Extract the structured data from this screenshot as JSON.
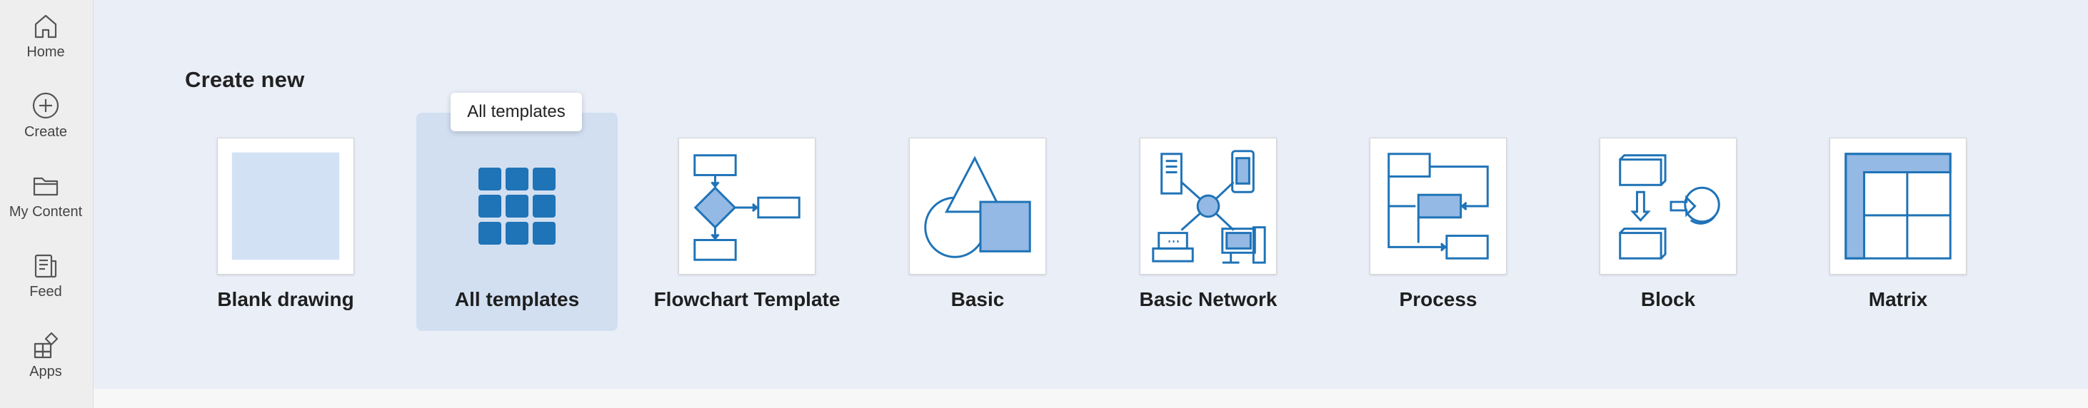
{
  "nav": {
    "items": [
      {
        "label": "Home",
        "icon": "home-icon"
      },
      {
        "label": "Create",
        "icon": "plus-circle-icon"
      },
      {
        "label": "My Content",
        "icon": "folder-icon"
      },
      {
        "label": "Feed",
        "icon": "feed-icon"
      },
      {
        "label": "Apps",
        "icon": "apps-icon"
      }
    ]
  },
  "main": {
    "section_title": "Create new",
    "tooltip": "All templates",
    "templates": [
      {
        "label": "Blank drawing",
        "icon": "blank-drawing-icon"
      },
      {
        "label": "All templates",
        "icon": "grid-icon",
        "selected": true
      },
      {
        "label": "Flowchart Template",
        "icon": "flowchart-icon"
      },
      {
        "label": "Basic",
        "icon": "basic-shapes-icon"
      },
      {
        "label": "Basic Network",
        "icon": "network-icon"
      },
      {
        "label": "Process",
        "icon": "process-icon"
      },
      {
        "label": "Block",
        "icon": "block-icon"
      },
      {
        "label": "Matrix",
        "icon": "matrix-icon"
      }
    ]
  },
  "colors": {
    "accent": "#1f73b7",
    "light_fill": "#93b9e4",
    "selected_bg": "#d1dff1",
    "main_bg": "#e9eef7"
  }
}
